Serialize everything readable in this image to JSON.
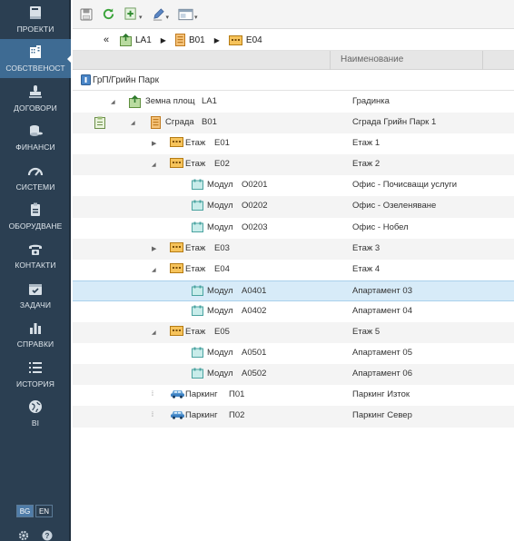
{
  "sidebar": {
    "items": [
      {
        "label": "ПРОЕКТИ",
        "icon": "book-icon"
      },
      {
        "label": "СОБСТВЕНОСТ",
        "icon": "building-icon",
        "active": true
      },
      {
        "label": "ДОГОВОРИ",
        "icon": "stamp-icon"
      },
      {
        "label": "ФИНАНСИ",
        "icon": "coins-icon"
      },
      {
        "label": "СИСТЕМИ",
        "icon": "gauge-icon"
      },
      {
        "label": "ОБОРУДВАНЕ",
        "icon": "clipboard-icon"
      },
      {
        "label": "КОНТАКТИ",
        "icon": "phone-icon"
      },
      {
        "label": "ЗАДАЧИ",
        "icon": "calendar-icon"
      },
      {
        "label": "СПРАВКИ",
        "icon": "bar-chart-icon"
      },
      {
        "label": "ИСТОРИЯ",
        "icon": "list-icon"
      },
      {
        "label": "BI",
        "icon": "globe-icon"
      }
    ],
    "languages": [
      {
        "code": "BG",
        "active": true
      },
      {
        "code": "EN",
        "active": false
      }
    ]
  },
  "breadcrumb": {
    "back": "«",
    "items": [
      {
        "label": "LA1",
        "icon": "land-icon"
      },
      {
        "label": "B01",
        "icon": "building-icon"
      },
      {
        "label": "E04",
        "icon": "floor-icon"
      }
    ],
    "separator": "▶"
  },
  "grid": {
    "column_name": "Наименование",
    "group_label": "ГрП/Грийн Парк",
    "rows": [
      {
        "level": 0,
        "toggle": "◢",
        "icon": "land",
        "type": "Земна площ",
        "code": "LA1",
        "name": "Градинка",
        "alt": false
      },
      {
        "level": 1,
        "toggle": "◢",
        "icon": "building",
        "type": "Сграда",
        "code": "B01",
        "name": "Сграда Грийн Парк 1",
        "alt": true,
        "side_icon": true
      },
      {
        "level": 2,
        "toggle": "▶",
        "icon": "floor",
        "type": "Етаж",
        "code": "E01",
        "name": "Етаж 1",
        "alt": false
      },
      {
        "level": 2,
        "toggle": "◢",
        "icon": "floor",
        "type": "Етаж",
        "code": "E02",
        "name": "Етаж 2",
        "alt": true
      },
      {
        "level": 3,
        "toggle": "",
        "icon": "module",
        "type": "Модул",
        "code": "O0201",
        "name": "Офис - Почисващи услуги",
        "alt": false
      },
      {
        "level": 3,
        "toggle": "",
        "icon": "module",
        "type": "Модул",
        "code": "O0202",
        "name": "Офис - Озеленяване",
        "alt": true
      },
      {
        "level": 3,
        "toggle": "",
        "icon": "module",
        "type": "Модул",
        "code": "O0203",
        "name": "Офис - Нобел",
        "alt": false
      },
      {
        "level": 2,
        "toggle": "▶",
        "icon": "floor",
        "type": "Етаж",
        "code": "E03",
        "name": "Етаж 3",
        "alt": true
      },
      {
        "level": 2,
        "toggle": "◢",
        "icon": "floor",
        "type": "Етаж",
        "code": "E04",
        "name": "Етаж 4",
        "alt": false
      },
      {
        "level": 3,
        "toggle": "",
        "icon": "module",
        "type": "Модул",
        "code": "A0401",
        "name": "Апартамент 03",
        "alt": false,
        "selected": true
      },
      {
        "level": 3,
        "toggle": "",
        "icon": "module",
        "type": "Модул",
        "code": "A0402",
        "name": "Апартамент 04",
        "alt": false
      },
      {
        "level": 2,
        "toggle": "◢",
        "icon": "floor",
        "type": "Етаж",
        "code": "E05",
        "name": "Етаж 5",
        "alt": true
      },
      {
        "level": 3,
        "toggle": "",
        "icon": "module",
        "type": "Модул",
        "code": "A0501",
        "name": "Апартамент 05",
        "alt": false
      },
      {
        "level": 3,
        "toggle": "",
        "icon": "module",
        "type": "Модул",
        "code": "A0502",
        "name": "Апартамент 06",
        "alt": true
      },
      {
        "level": 2,
        "toggle": "⁞",
        "icon": "car",
        "type": "Паркинг",
        "code": "П01",
        "name": "Паркинг Изток",
        "alt": false
      },
      {
        "level": 2,
        "toggle": "⁞",
        "icon": "car",
        "type": "Паркинг",
        "code": "П02",
        "name": "Паркинг Север",
        "alt": true
      }
    ]
  }
}
